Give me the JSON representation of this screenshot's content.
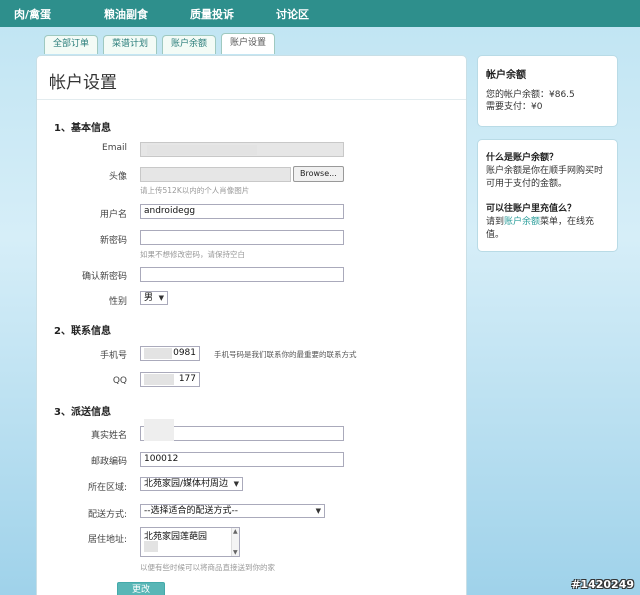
{
  "topnav": {
    "items": [
      "肉/禽蛋",
      "粮油副食",
      "质量投诉",
      "讨论区"
    ]
  },
  "tabs": [
    "全部订单",
    "菜谱计划",
    "账户余额",
    "账户设置"
  ],
  "page_title": "帐户设置",
  "sections": {
    "basic": "1、基本信息",
    "contact": "2、联系信息",
    "delivery": "3、派送信息"
  },
  "form": {
    "email_label": "Email",
    "avatar_label": "头像",
    "browse_label": "Browse...",
    "avatar_hint": "请上传512K以内的个人肖像图片",
    "username_label": "用户名",
    "username_value": "androidegg",
    "new_password_label": "新密码",
    "password_hint": "如果不想修改密码，请保持空白",
    "confirm_password_label": "确认新密码",
    "gender_label": "性别",
    "gender_value": "男",
    "phone_label": "手机号",
    "phone_value": "0981",
    "phone_hint": "手机号码是我们联系你的最重要的联系方式",
    "qq_label": "QQ",
    "qq_value": "177",
    "realname_label": "真实姓名",
    "zip_label": "邮政编码",
    "zip_value": "100012",
    "region_label": "所在区域:",
    "region_value": "北苑家园/媒体村周边",
    "delivery_label": "配送方式:",
    "delivery_value": "--选择适合的配送方式--",
    "address_label": "居住地址:",
    "address_value": "北苑家园莲葩园",
    "address_hint": "以便有些时候可以将商品直接送到你的家",
    "submit_label": "更改"
  },
  "balance_box": {
    "title": "帐户余额",
    "balance_line": "您的帐户余额：¥86.5",
    "due_line": "需要支付：¥0"
  },
  "help_box": {
    "q1": "什么是账户余额？",
    "a1": "账户余额是你在顺手网购买时可用于支付的金额。",
    "q2": "可以往账户里充值么？",
    "a2_prefix": "请到",
    "a2_link": "账户余额",
    "a2_suffix": "菜单，在线充值。"
  },
  "watermark": "#1420249"
}
